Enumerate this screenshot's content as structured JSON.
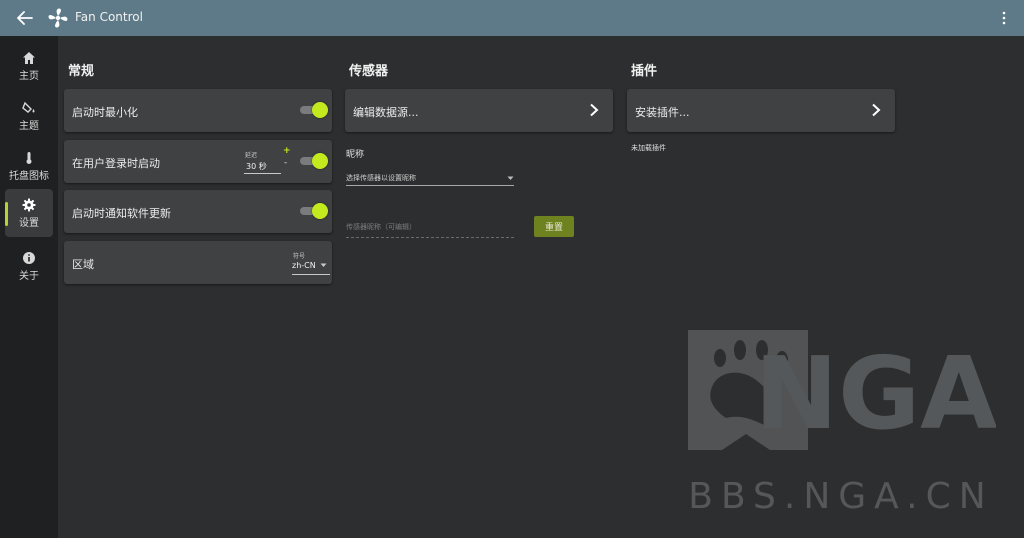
{
  "app": {
    "title": "Fan Control"
  },
  "sidebar": {
    "items": [
      {
        "label": "主页",
        "icon": "home-icon"
      },
      {
        "label": "主题",
        "icon": "paint-bucket-icon"
      },
      {
        "label": "托盘图标",
        "icon": "thermometer-icon"
      },
      {
        "label": "设置",
        "icon": "gear-icon",
        "active": true
      },
      {
        "label": "关于",
        "icon": "info-icon"
      }
    ]
  },
  "general": {
    "title": "常规",
    "minimize_on_start": {
      "label": "启动时最小化",
      "on": true
    },
    "start_on_login": {
      "label": "在用户登录时启动",
      "delay_label": "延迟",
      "delay_value": "30 秒",
      "plus": "+",
      "minus": "-",
      "on": true
    },
    "notify_updates": {
      "label": "启动时通知软件更新",
      "on": true
    },
    "region": {
      "label": "区域",
      "symbol_label": "符号",
      "value": "zh-CN"
    }
  },
  "sensors": {
    "title": "传感器",
    "edit_data_source": "编辑数据源...",
    "nickname_label": "昵称",
    "select_placeholder": "选择传感器以设置昵称",
    "nickname_placeholder": "传感器昵称（可编辑）",
    "reset_label": "重置"
  },
  "plugins": {
    "title": "插件",
    "install": "安装插件...",
    "none_loaded": "未加载插件"
  },
  "watermark": {
    "url": "BBS.NGA.CN",
    "logo_text": "NGA"
  },
  "colors": {
    "accent": "#c3ea1f",
    "titlebar": "#5e7a88",
    "reset_button": "#6f8220"
  }
}
